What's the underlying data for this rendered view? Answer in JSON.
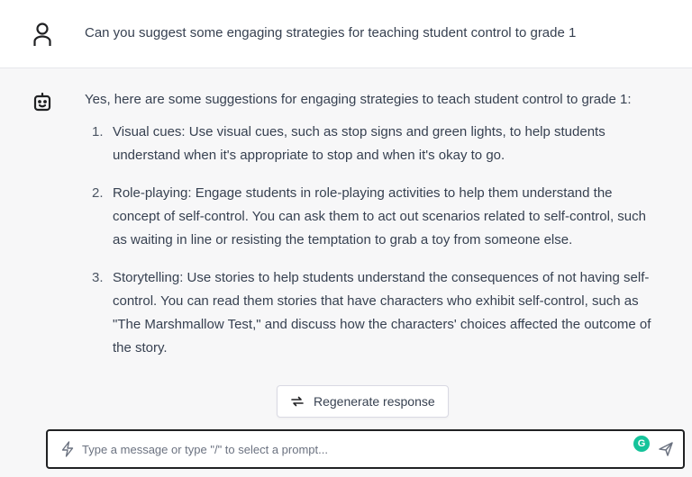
{
  "user_message": {
    "text": "Can you suggest some engaging strategies for teaching student control to grade 1",
    "icon": "user-icon"
  },
  "assistant_message": {
    "icon": "bot-icon",
    "intro": "Yes, here are some suggestions for engaging strategies to teach student control to grade 1:",
    "items": [
      {
        "num": "1.",
        "text": "Visual cues: Use visual cues, such as stop signs and green lights, to help students understand when it's appropriate to stop and when it's okay to go."
      },
      {
        "num": "2.",
        "text": "Role-playing: Engage students in role-playing activities to help them understand the concept of self-control. You can ask them to act out scenarios related to self-control, such as waiting in line or resisting the temptation to grab a toy from someone else."
      },
      {
        "num": "3.",
        "text": "Storytelling: Use stories to help students understand the consequences of not having self-control. You can read them stories that have characters who exhibit self-control, such as \"The Marshmallow Test,\" and discuss how the characters' choices affected the outcome of the story."
      }
    ]
  },
  "regenerate": {
    "label": "Regenerate response",
    "icon": "regenerate-icon"
  },
  "composer": {
    "placeholder": "Type a message or type \"/\" to select a prompt...",
    "value": "",
    "prompt_icon": "lightning-icon",
    "grammarly_badge": "G",
    "send_icon": "send-icon"
  },
  "colors": {
    "assistant_bg": "#f7f7f8",
    "text": "#374151",
    "grammarly": "#15c39a",
    "input_border": "#202123"
  }
}
